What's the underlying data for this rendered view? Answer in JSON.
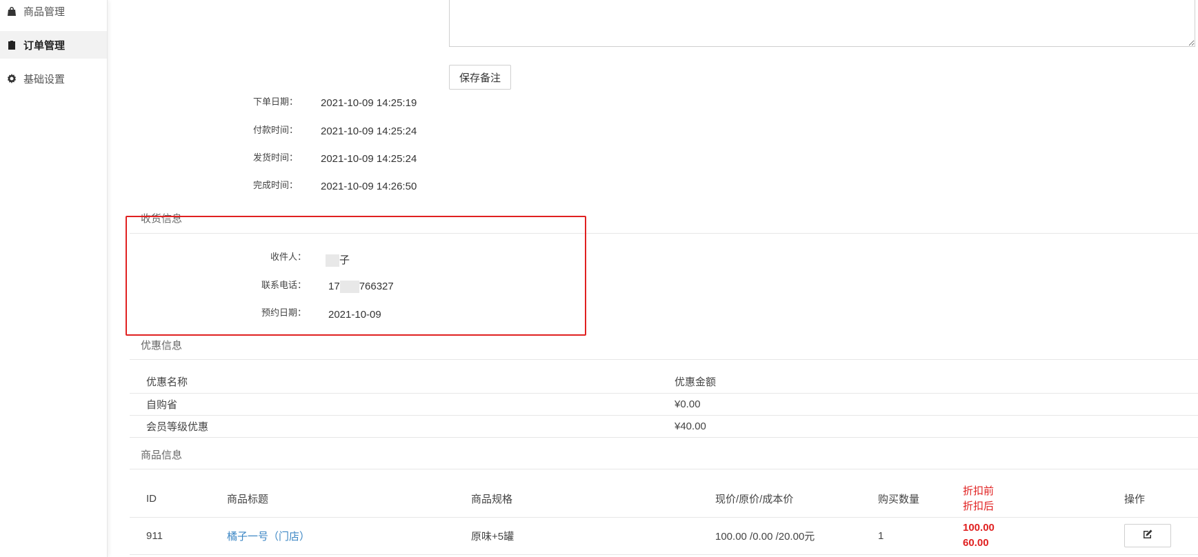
{
  "sidebar": {
    "items": [
      {
        "label": "商品管理",
        "icon": "bag-icon"
      },
      {
        "label": "订单管理",
        "icon": "clipboard-icon"
      },
      {
        "label": "基础设置",
        "icon": "gear-icon"
      }
    ]
  },
  "remark": {
    "save_label": "保存备注"
  },
  "dates": [
    {
      "label": "下单日期：",
      "value": "2021-10-09 14:25:19"
    },
    {
      "label": "付款时间：",
      "value": "2021-10-09 14:25:24"
    },
    {
      "label": "发货时间：",
      "value": "2021-10-09 14:25:24"
    },
    {
      "label": "完成时间：",
      "value": "2021-10-09 14:26:50"
    }
  ],
  "shipping": {
    "title": "收货信息",
    "receiver_label": "收件人：",
    "receiver_suffix": "子",
    "phone_label": "联系电话：",
    "phone_prefix": "17",
    "phone_suffix": "766327",
    "date_label": "预约日期：",
    "date_value": "2021-10-09"
  },
  "discount": {
    "title": "优惠信息",
    "headers": [
      "优惠名称",
      "优惠金额"
    ],
    "rows": [
      [
        "自购省",
        "¥0.00"
      ],
      [
        "会员等级优惠",
        "¥40.00"
      ]
    ]
  },
  "goods": {
    "title": "商品信息",
    "headers": {
      "id": "ID",
      "title": "商品标题",
      "spec": "商品规格",
      "price": "现价/原价/成本价",
      "qty": "购买数量",
      "before": "折扣前",
      "after": "折扣后",
      "op": "操作"
    },
    "rows": [
      {
        "id": "911",
        "title": "橘子一号（门店）",
        "spec": "原味+5罐",
        "price": "100.00 /0.00 /20.00元",
        "qty": "1",
        "before": "100.00",
        "after": "60.00"
      }
    ]
  },
  "colors": {
    "accent_red": "#e02020",
    "link_blue": "#3b86c4"
  }
}
